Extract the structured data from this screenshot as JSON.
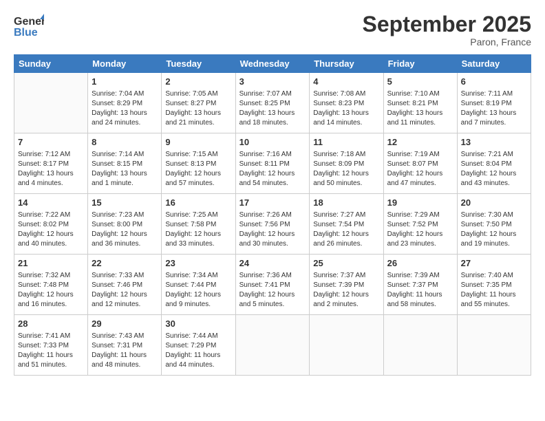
{
  "logo": {
    "general": "General",
    "blue": "Blue"
  },
  "header": {
    "month": "September 2025",
    "location": "Paron, France"
  },
  "weekdays": [
    "Sunday",
    "Monday",
    "Tuesday",
    "Wednesday",
    "Thursday",
    "Friday",
    "Saturday"
  ],
  "weeks": [
    [
      null,
      {
        "num": "1",
        "sunrise": "7:04 AM",
        "sunset": "8:29 PM",
        "daylight": "13 hours and 24 minutes."
      },
      {
        "num": "2",
        "sunrise": "7:05 AM",
        "sunset": "8:27 PM",
        "daylight": "13 hours and 21 minutes."
      },
      {
        "num": "3",
        "sunrise": "7:07 AM",
        "sunset": "8:25 PM",
        "daylight": "13 hours and 18 minutes."
      },
      {
        "num": "4",
        "sunrise": "7:08 AM",
        "sunset": "8:23 PM",
        "daylight": "13 hours and 14 minutes."
      },
      {
        "num": "5",
        "sunrise": "7:10 AM",
        "sunset": "8:21 PM",
        "daylight": "13 hours and 11 minutes."
      },
      {
        "num": "6",
        "sunrise": "7:11 AM",
        "sunset": "8:19 PM",
        "daylight": "13 hours and 7 minutes."
      }
    ],
    [
      {
        "num": "7",
        "sunrise": "7:12 AM",
        "sunset": "8:17 PM",
        "daylight": "13 hours and 4 minutes."
      },
      {
        "num": "8",
        "sunrise": "7:14 AM",
        "sunset": "8:15 PM",
        "daylight": "13 hours and 1 minute."
      },
      {
        "num": "9",
        "sunrise": "7:15 AM",
        "sunset": "8:13 PM",
        "daylight": "12 hours and 57 minutes."
      },
      {
        "num": "10",
        "sunrise": "7:16 AM",
        "sunset": "8:11 PM",
        "daylight": "12 hours and 54 minutes."
      },
      {
        "num": "11",
        "sunrise": "7:18 AM",
        "sunset": "8:09 PM",
        "daylight": "12 hours and 50 minutes."
      },
      {
        "num": "12",
        "sunrise": "7:19 AM",
        "sunset": "8:07 PM",
        "daylight": "12 hours and 47 minutes."
      },
      {
        "num": "13",
        "sunrise": "7:21 AM",
        "sunset": "8:04 PM",
        "daylight": "12 hours and 43 minutes."
      }
    ],
    [
      {
        "num": "14",
        "sunrise": "7:22 AM",
        "sunset": "8:02 PM",
        "daylight": "12 hours and 40 minutes."
      },
      {
        "num": "15",
        "sunrise": "7:23 AM",
        "sunset": "8:00 PM",
        "daylight": "12 hours and 36 minutes."
      },
      {
        "num": "16",
        "sunrise": "7:25 AM",
        "sunset": "7:58 PM",
        "daylight": "12 hours and 33 minutes."
      },
      {
        "num": "17",
        "sunrise": "7:26 AM",
        "sunset": "7:56 PM",
        "daylight": "12 hours and 30 minutes."
      },
      {
        "num": "18",
        "sunrise": "7:27 AM",
        "sunset": "7:54 PM",
        "daylight": "12 hours and 26 minutes."
      },
      {
        "num": "19",
        "sunrise": "7:29 AM",
        "sunset": "7:52 PM",
        "daylight": "12 hours and 23 minutes."
      },
      {
        "num": "20",
        "sunrise": "7:30 AM",
        "sunset": "7:50 PM",
        "daylight": "12 hours and 19 minutes."
      }
    ],
    [
      {
        "num": "21",
        "sunrise": "7:32 AM",
        "sunset": "7:48 PM",
        "daylight": "12 hours and 16 minutes."
      },
      {
        "num": "22",
        "sunrise": "7:33 AM",
        "sunset": "7:46 PM",
        "daylight": "12 hours and 12 minutes."
      },
      {
        "num": "23",
        "sunrise": "7:34 AM",
        "sunset": "7:44 PM",
        "daylight": "12 hours and 9 minutes."
      },
      {
        "num": "24",
        "sunrise": "7:36 AM",
        "sunset": "7:41 PM",
        "daylight": "12 hours and 5 minutes."
      },
      {
        "num": "25",
        "sunrise": "7:37 AM",
        "sunset": "7:39 PM",
        "daylight": "12 hours and 2 minutes."
      },
      {
        "num": "26",
        "sunrise": "7:39 AM",
        "sunset": "7:37 PM",
        "daylight": "11 hours and 58 minutes."
      },
      {
        "num": "27",
        "sunrise": "7:40 AM",
        "sunset": "7:35 PM",
        "daylight": "11 hours and 55 minutes."
      }
    ],
    [
      {
        "num": "28",
        "sunrise": "7:41 AM",
        "sunset": "7:33 PM",
        "daylight": "11 hours and 51 minutes."
      },
      {
        "num": "29",
        "sunrise": "7:43 AM",
        "sunset": "7:31 PM",
        "daylight": "11 hours and 48 minutes."
      },
      {
        "num": "30",
        "sunrise": "7:44 AM",
        "sunset": "7:29 PM",
        "daylight": "11 hours and 44 minutes."
      },
      null,
      null,
      null,
      null
    ]
  ],
  "labels": {
    "sunrise": "Sunrise:",
    "sunset": "Sunset:",
    "daylight": "Daylight:"
  }
}
